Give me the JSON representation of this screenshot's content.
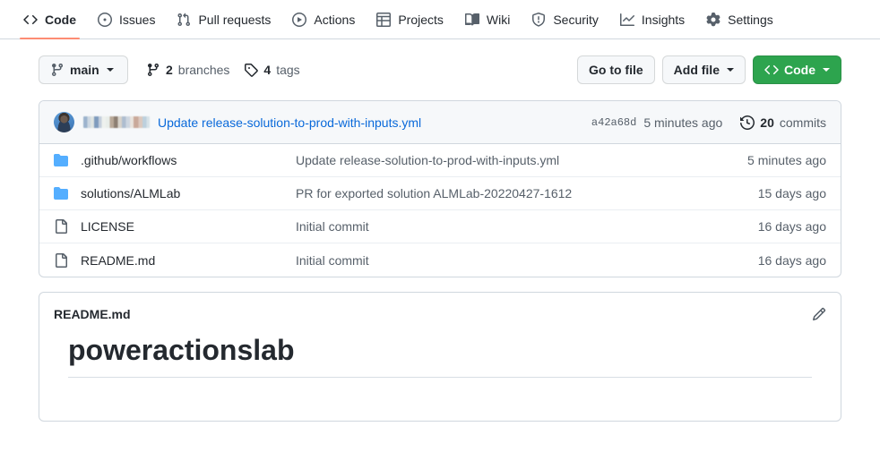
{
  "nav": {
    "items": [
      {
        "label": "Code",
        "icon": "code-icon",
        "active": true
      },
      {
        "label": "Issues",
        "icon": "issue-opened-icon",
        "active": false
      },
      {
        "label": "Pull requests",
        "icon": "git-pull-request-icon",
        "active": false
      },
      {
        "label": "Actions",
        "icon": "play-icon",
        "active": false
      },
      {
        "label": "Projects",
        "icon": "table-icon",
        "active": false
      },
      {
        "label": "Wiki",
        "icon": "book-icon",
        "active": false
      },
      {
        "label": "Security",
        "icon": "shield-icon",
        "active": false
      },
      {
        "label": "Insights",
        "icon": "graph-icon",
        "active": false
      }
    ],
    "settings_label": "Settings"
  },
  "toolbar": {
    "branch": "main",
    "branches_count": "2",
    "branches_label": "branches",
    "tags_count": "4",
    "tags_label": "tags",
    "go_to_file": "Go to file",
    "add_file": "Add file",
    "code": "Code"
  },
  "commit_header": {
    "author_redacted": true,
    "message": "Update release-solution-to-prod-with-inputs.yml",
    "sha": "a42a68d",
    "age": "5 minutes ago",
    "commits_count": "20",
    "commits_label": "commits"
  },
  "files": {
    "rows": [
      {
        "name": ".github/workflows",
        "type": "folder",
        "commit": "Update release-solution-to-prod-with-inputs.yml",
        "age": "5 minutes ago"
      },
      {
        "name": "solutions/ALMLab",
        "type": "folder",
        "commit": "PR for exported solution ALMLab-20220427-1612",
        "age": "15 days ago"
      },
      {
        "name": "LICENSE",
        "type": "file",
        "commit": "Initial commit",
        "age": "16 days ago"
      },
      {
        "name": "README.md",
        "type": "file",
        "commit": "Initial commit",
        "age": "16 days ago"
      }
    ]
  },
  "readme": {
    "title": "README.md",
    "heading": "poweractionslab",
    "edit_icon": "pencil-icon"
  },
  "colors": {
    "accent_blue": "#0969da",
    "green_button": "#2da44e",
    "active_tab_underline": "#fd8c73",
    "folder_blue": "#54aeff",
    "border": "#d0d7de",
    "muted_text": "#57606a",
    "header_bg": "#f6f8fa"
  }
}
